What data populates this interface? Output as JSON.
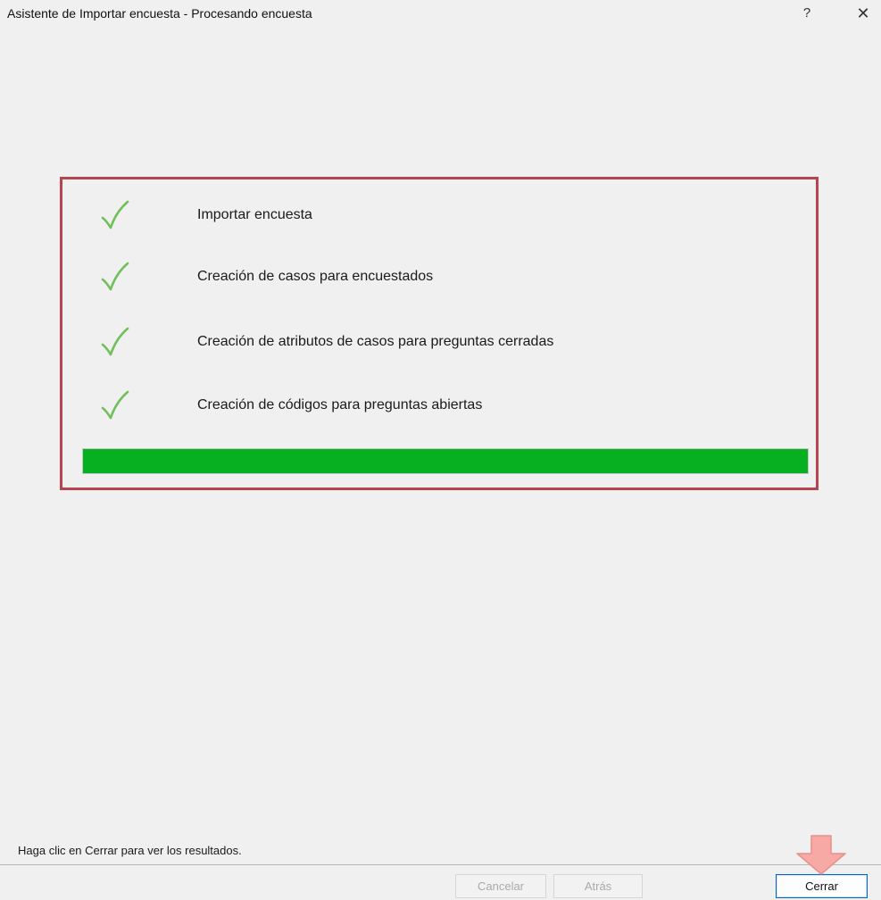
{
  "window": {
    "title": "Asistente de Importar encuesta - Procesando encuesta",
    "help_glyph": "?",
    "close_glyph": "✕"
  },
  "steps": [
    {
      "label": "Importar encuesta",
      "status": "done",
      "icon": "checkmark-icon"
    },
    {
      "label": "Creación de casos para encuestados",
      "status": "done",
      "icon": "checkmark-icon"
    },
    {
      "label": "Creación de atributos de casos para preguntas cerradas",
      "status": "done",
      "icon": "checkmark-icon"
    },
    {
      "label": "Creación de códigos para preguntas abiertas",
      "status": "done",
      "icon": "checkmark-icon"
    }
  ],
  "progress": {
    "percent": 100,
    "color": "#07b021"
  },
  "highlight_color": "#b54650",
  "footer": {
    "status": "Haga clic en Cerrar para ver los resultados.",
    "buttons": {
      "cancel": "Cancelar",
      "back": "Atrás",
      "close": "Cerrar"
    }
  },
  "annotation": {
    "icon": "down-arrow-icon",
    "color": "#f4a0a0"
  }
}
